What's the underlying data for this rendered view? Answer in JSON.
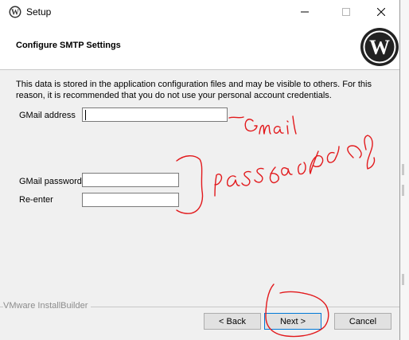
{
  "window": {
    "title": "Setup",
    "icon": "wordpress-icon",
    "controls": [
      "minimize-icon",
      "maximize-icon",
      "close-icon"
    ]
  },
  "header": {
    "title": "Configure SMTP Settings",
    "logo": "wordpress-logo"
  },
  "description": "This data is stored in the application configuration files and may be visible to others. For this reason, it is recommended that you do not use your personal account credentials.",
  "form": {
    "gmail_address": {
      "label": "GMail address",
      "value": ""
    },
    "gmail_password": {
      "label": "GMail password",
      "value": ""
    },
    "reenter": {
      "label": "Re-enter",
      "value": ""
    }
  },
  "annotations": {
    "gmail_note": "Gmail",
    "password_note": "password",
    "color": "#e2191c"
  },
  "footer": {
    "brand": "VMware InstallBuilder",
    "back_label": "< Back",
    "next_label": "Next >",
    "cancel_label": "Cancel"
  }
}
